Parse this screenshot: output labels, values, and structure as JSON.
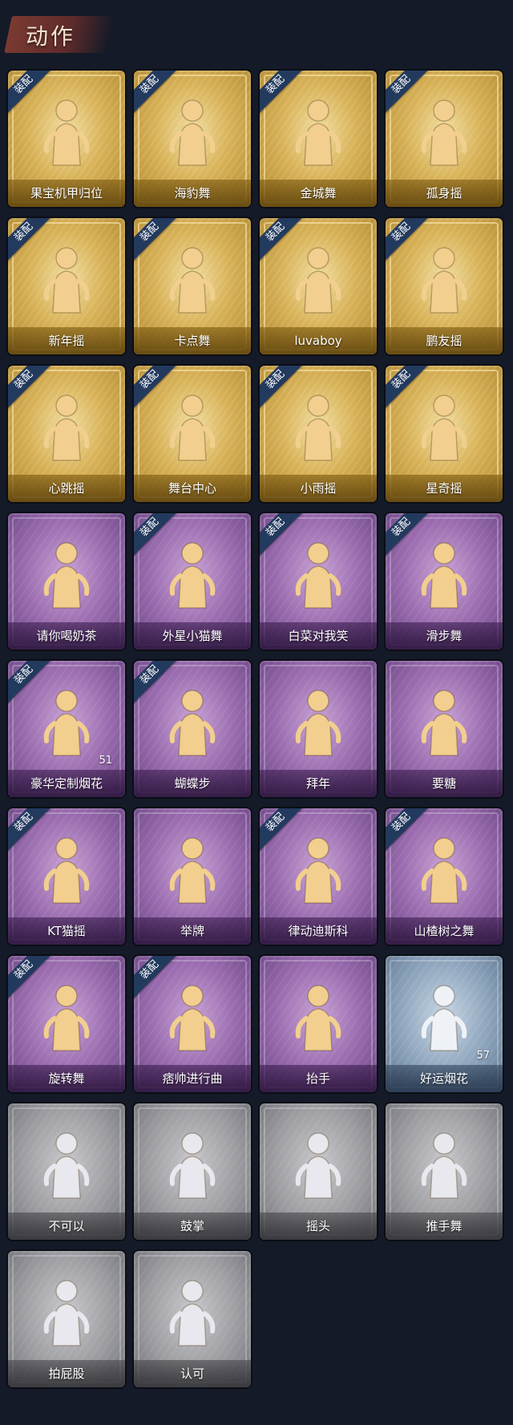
{
  "header": {
    "title": "动作"
  },
  "badge_text": "装配",
  "colors": {
    "background": "#141a27",
    "gold": "#d8b257",
    "purple": "#9b6db0",
    "blue": "#8ca3bb",
    "gray": "#9c9ca1",
    "badge": "#233a5f"
  },
  "actions": [
    {
      "label": "果宝机甲归位",
      "tier": "gold",
      "equipped": true
    },
    {
      "label": "海豹舞",
      "tier": "gold",
      "equipped": true
    },
    {
      "label": "金城舞",
      "tier": "gold",
      "equipped": true
    },
    {
      "label": "孤身摇",
      "tier": "gold",
      "equipped": true
    },
    {
      "label": "新年摇",
      "tier": "gold",
      "equipped": true
    },
    {
      "label": "卡点舞",
      "tier": "gold",
      "equipped": true
    },
    {
      "label": "luvaboy",
      "tier": "gold",
      "equipped": true
    },
    {
      "label": "鹏友摇",
      "tier": "gold",
      "equipped": true
    },
    {
      "label": "心跳摇",
      "tier": "gold",
      "equipped": true
    },
    {
      "label": "舞台中心",
      "tier": "gold",
      "equipped": true
    },
    {
      "label": "小雨摇",
      "tier": "gold",
      "equipped": true
    },
    {
      "label": "星奇摇",
      "tier": "gold",
      "equipped": true
    },
    {
      "label": "请你喝奶茶",
      "tier": "purple",
      "equipped": false
    },
    {
      "label": "外星小猫舞",
      "tier": "purple",
      "equipped": true
    },
    {
      "label": "白菜对我笑",
      "tier": "purple",
      "equipped": true
    },
    {
      "label": "滑步舞",
      "tier": "purple",
      "equipped": true
    },
    {
      "label": "豪华定制烟花",
      "tier": "purple",
      "equipped": true,
      "quantity": "51"
    },
    {
      "label": "蝴蝶步",
      "tier": "purple",
      "equipped": true
    },
    {
      "label": "拜年",
      "tier": "purple",
      "equipped": false
    },
    {
      "label": "要糖",
      "tier": "purple",
      "equipped": false
    },
    {
      "label": "KT猫摇",
      "tier": "purple",
      "equipped": true
    },
    {
      "label": "举牌",
      "tier": "purple",
      "equipped": false
    },
    {
      "label": "律动迪斯科",
      "tier": "purple",
      "equipped": true
    },
    {
      "label": "山楂树之舞",
      "tier": "purple",
      "equipped": true
    },
    {
      "label": "旋转舞",
      "tier": "purple",
      "equipped": true
    },
    {
      "label": "痞帅进行曲",
      "tier": "purple",
      "equipped": true
    },
    {
      "label": "抬手",
      "tier": "purple",
      "equipped": false
    },
    {
      "label": "好运烟花",
      "tier": "blue",
      "equipped": false,
      "quantity": "57"
    },
    {
      "label": "不可以",
      "tier": "gray",
      "equipped": false
    },
    {
      "label": "鼓掌",
      "tier": "gray",
      "equipped": false
    },
    {
      "label": "摇头",
      "tier": "gray",
      "equipped": false
    },
    {
      "label": "推手舞",
      "tier": "gray",
      "equipped": false
    },
    {
      "label": "拍屁股",
      "tier": "gray",
      "equipped": false
    },
    {
      "label": "认可",
      "tier": "gray",
      "equipped": false
    }
  ]
}
